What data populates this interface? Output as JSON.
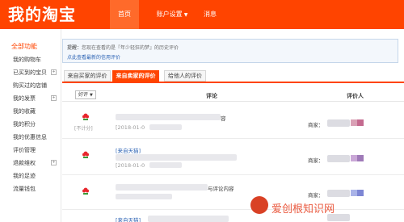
{
  "header": {
    "logo": "我的淘宝",
    "nav": [
      {
        "label": "首页",
        "active": true
      },
      {
        "label": "账户设置",
        "has_dropdown": true
      },
      {
        "label": "消息"
      }
    ]
  },
  "sidebar": {
    "heading": "全部功能",
    "items": [
      {
        "label": "我的购物车",
        "expandable": false
      },
      {
        "label": "已买到的宝贝",
        "expandable": true
      },
      {
        "label": "购买过的店铺",
        "expandable": false
      },
      {
        "label": "我的发票",
        "expandable": true
      },
      {
        "label": "我的收藏",
        "expandable": false
      },
      {
        "label": "我的积分",
        "expandable": false
      },
      {
        "label": "我的优惠信息",
        "expandable": false
      },
      {
        "label": "评价管理",
        "expandable": false
      },
      {
        "label": "退款维权",
        "expandable": true
      },
      {
        "label": "我的足迹",
        "expandable": false
      },
      {
        "label": "流量钱包",
        "expandable": false
      }
    ]
  },
  "notice": {
    "prefix": "提醒：",
    "text": "您现在查看的是『年少轻狂的梦』的历史评价",
    "link": "点此查看最新的信用评价"
  },
  "tabs": [
    {
      "label": "来自买家的评价",
      "active": false
    },
    {
      "label": "来自卖家的评价",
      "active": true
    },
    {
      "label": "给他人的评价",
      "active": false
    }
  ],
  "table": {
    "filter_label": "好评",
    "comment_header": "评论",
    "reviewer_header": "评价人",
    "rows": [
      {
        "rating_label": "[不计分]",
        "comment_tail": "容",
        "date_prefix": "[2018-01-0",
        "seller_label": "商家："
      },
      {
        "rating_label": "",
        "source": "[来自天猫]",
        "date_prefix": "[2018-01-0",
        "seller_label": "商家："
      },
      {
        "rating_label": "",
        "comment_tail": "与评论内容",
        "date_prefix": "",
        "seller_label": "商家："
      },
      {
        "rating_label": "",
        "source": "[来自天猫]",
        "date_prefix": "",
        "seller_label": ""
      }
    ]
  },
  "colors": {
    "brand": "#ff4400",
    "link": "#2c63b4",
    "flower": "#e8262d",
    "leaf": "#3a9a37"
  },
  "watermark": {
    "text": "爱创根知识网"
  }
}
